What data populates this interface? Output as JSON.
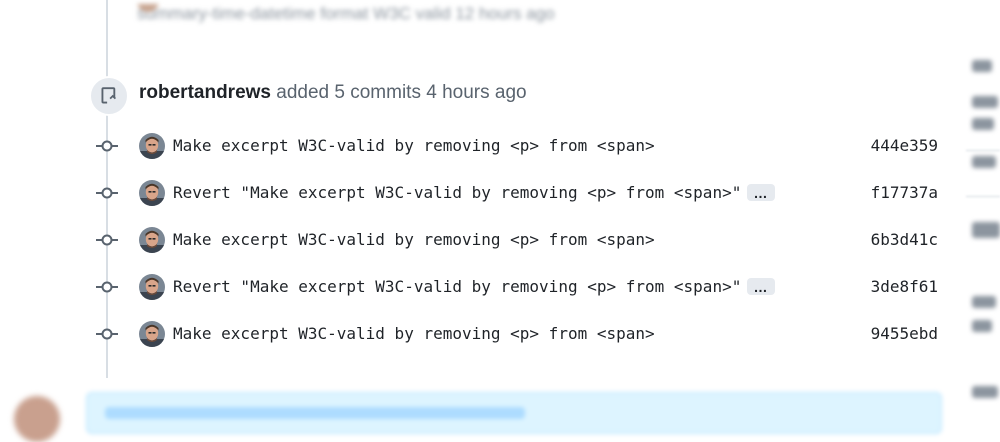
{
  "blurred_context": {
    "prior_line": "summary-time-datetime format W3C valid 12 hours ago"
  },
  "event": {
    "author": "robertandrews",
    "action": "added 5 commits 4 hours ago"
  },
  "commits": [
    {
      "message": "Make excerpt W3C-valid by removing <p> from <span>",
      "sha": "444e359",
      "has_more": false
    },
    {
      "message": "Revert \"Make excerpt W3C-valid by removing <p> from <span>\"",
      "sha": "f17737a",
      "has_more": true,
      "more_label": "…"
    },
    {
      "message": "Make excerpt W3C-valid by removing <p> from <span>",
      "sha": "6b3d41c",
      "has_more": false
    },
    {
      "message": "Revert \"Make excerpt W3C-valid by removing <p> from <span>\"",
      "sha": "3de8f61",
      "has_more": true,
      "more_label": "…"
    },
    {
      "message": "Make excerpt W3C-valid by removing <p> from <span>",
      "sha": "9455ebd",
      "has_more": false
    }
  ],
  "colors": {
    "timeline": "#d8dee4",
    "icon_bg": "#e6eaef",
    "muted_text": "#59636e"
  },
  "icons": {
    "event": "repo-push-icon",
    "commit": "git-commit-icon"
  }
}
